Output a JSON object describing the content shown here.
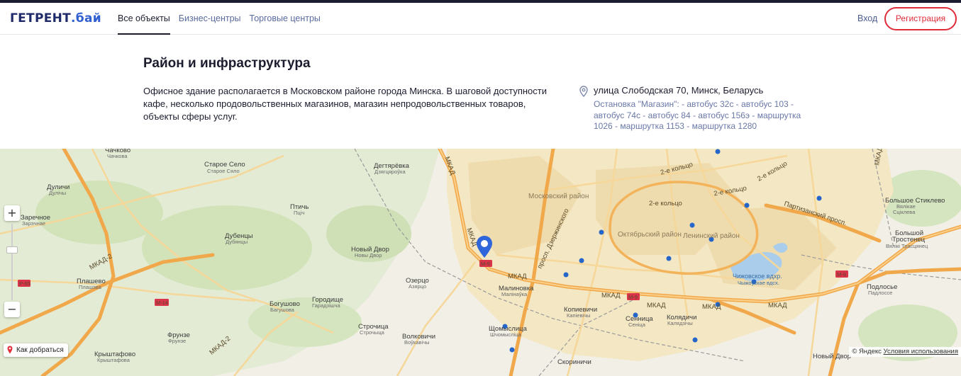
{
  "header": {
    "logo_main": "ГЕТРЕНТ",
    "logo_suffix": ".бай",
    "nav": [
      {
        "label": "Все объекты",
        "active": true
      },
      {
        "label": "Бизнес-центры",
        "active": false
      },
      {
        "label": "Торговые центры",
        "active": false
      }
    ],
    "login_label": "Вход",
    "register_label": "Регистрация"
  },
  "section": {
    "title": "Район и инфраструктура",
    "description": "Офисное здание располагается в Московском районе города Минска. В шаговой доступности кафе, несколько продовольственных магазинов, магазин непродовольственных товаров, объекты сферы услуг.",
    "address": "улица Слободская 70, Минск, Беларусь",
    "stops": "Остановка \"Магазин\": - автобус 32с - автобус 103 - автобус 74с - автобус 84 - автобус 156э - маршрутка 1026 - маршрутка 1153 - маршрутка 1280"
  },
  "map": {
    "zoom_in": "+",
    "zoom_out": "−",
    "route_label": "Как добраться",
    "copyright": "© Яндекс",
    "terms_label": "Условия использования",
    "places": [
      {
        "name": "Чачково",
        "sub": "Чачкова"
      },
      {
        "name": "Старое Село",
        "sub": "Старое Сяло"
      },
      {
        "name": "Дегтярёвка",
        "sub": "Дзягцяроўка"
      },
      {
        "name": "Дуличи",
        "sub": "Дулічы"
      },
      {
        "name": "Птичь",
        "sub": "Пціч"
      },
      {
        "name": "Заречное",
        "sub": "Зарэчнае"
      },
      {
        "name": "Дубенцы",
        "sub": "Дубянцы"
      },
      {
        "name": "Новый Двор",
        "sub": "Новы Двор"
      },
      {
        "name": "Плашево",
        "sub": "Плашэва"
      },
      {
        "name": "Озерцо",
        "sub": "Азярцо"
      },
      {
        "name": "Богушово",
        "sub": "Багушова"
      },
      {
        "name": "Городище",
        "sub": "Гарадзішча"
      },
      {
        "name": "Малиновка",
        "sub": "Малінаўка"
      },
      {
        "name": "Копиевичи",
        "sub": "Капіевічы"
      },
      {
        "name": "Сенница",
        "sub": "Сеніца"
      },
      {
        "name": "Колядичи",
        "sub": "Калядзічы"
      },
      {
        "name": "Фрунзе",
        "sub": "Фрунзе"
      },
      {
        "name": "Строчица",
        "sub": "Строчыца"
      },
      {
        "name": "Волковичи",
        "sub": "Воўкавічы"
      },
      {
        "name": "Щомыслица",
        "sub": "Шчомысліца"
      },
      {
        "name": "Крыштафово",
        "sub": "Крыштафова"
      },
      {
        "name": "Большое Стиклево",
        "sub": "Вялікае Сцікleva"
      },
      {
        "name": "Большой Тростенец",
        "sub": "Вялікі Трасцянец"
      },
      {
        "name": "Подлосье",
        "sub": "Падлоссе"
      },
      {
        "name": "Новый Двор",
        "sub": ""
      },
      {
        "name": "Скориничи",
        "sub": ""
      }
    ],
    "districts": [
      "Московский район",
      "Октябрьский район",
      "Ленинский район"
    ],
    "water": {
      "name": "Чижовское вдхр.",
      "sub": "Чыжоўскае вдсх."
    },
    "roads": [
      "МКАД",
      "МКАД-2",
      "2-е кольцо",
      "Партизанский просп.",
      "просп. Дзержинского"
    ],
    "route_shields": [
      "М-9",
      "Р-65",
      "М-14",
      "М-9",
      "М-9"
    ]
  }
}
